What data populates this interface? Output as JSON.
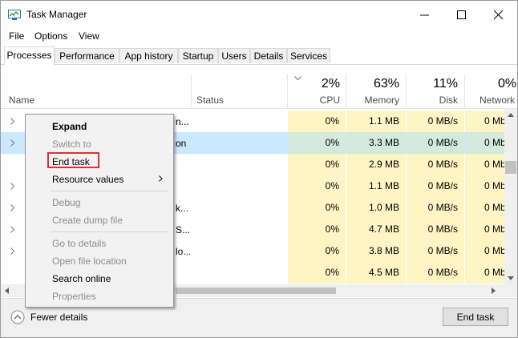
{
  "window": {
    "title": "Task Manager"
  },
  "menu": [
    "File",
    "Options",
    "View"
  ],
  "tabs": [
    "Processes",
    "Performance",
    "App history",
    "Startup",
    "Users",
    "Details",
    "Services"
  ],
  "columns": {
    "name": "Name",
    "status": "Status",
    "cpu": {
      "pct": "2%",
      "label": "CPU"
    },
    "memory": {
      "pct": "63%",
      "label": "Memory"
    },
    "disk": {
      "pct": "11%",
      "label": "Disk"
    },
    "network": {
      "pct": "0%",
      "label": "Network"
    }
  },
  "rows": [
    {
      "name_fragment": "n...",
      "cpu": "0%",
      "memory": "1.1 MB",
      "disk": "0 MB/s",
      "network": "0 Mb"
    },
    {
      "name_fragment": "on",
      "cpu": "0%",
      "memory": "3.3 MB",
      "disk": "0 MB/s",
      "network": "0 Mb"
    },
    {
      "name_fragment": "",
      "cpu": "0%",
      "memory": "2.9 MB",
      "disk": "0 MB/s",
      "network": "0 Mb"
    },
    {
      "name_fragment": "",
      "cpu": "0%",
      "memory": "1.1 MB",
      "disk": "0 MB/s",
      "network": "0 Mb"
    },
    {
      "name_fragment": "k...",
      "cpu": "0%",
      "memory": "1.0 MB",
      "disk": "0 MB/s",
      "network": "0 Mb"
    },
    {
      "name_fragment": "S...",
      "cpu": "0%",
      "memory": "4.7 MB",
      "disk": "0 MB/s",
      "network": "0 Mb"
    },
    {
      "name_fragment": "lo...",
      "cpu": "0%",
      "memory": "3.8 MB",
      "disk": "0 MB/s",
      "network": "0 Mb"
    },
    {
      "name_fragment": "",
      "cpu": "0%",
      "memory": "4.5 MB",
      "disk": "0 MB/s",
      "network": "0 Mb"
    }
  ],
  "context_menu": {
    "expand": "Expand",
    "switch_to": "Switch to",
    "end_task": "End task",
    "resource_values": "Resource values",
    "debug": "Debug",
    "create_dump": "Create dump file",
    "go_to_details": "Go to details",
    "open_file_location": "Open file location",
    "search_online": "Search online",
    "properties": "Properties"
  },
  "footer": {
    "fewer_details": "Fewer details",
    "end_task_button": "End task"
  },
  "colors": {
    "heat": "#fff4c4",
    "selected": "#cce8ff",
    "highlight_border": "#e03131"
  }
}
